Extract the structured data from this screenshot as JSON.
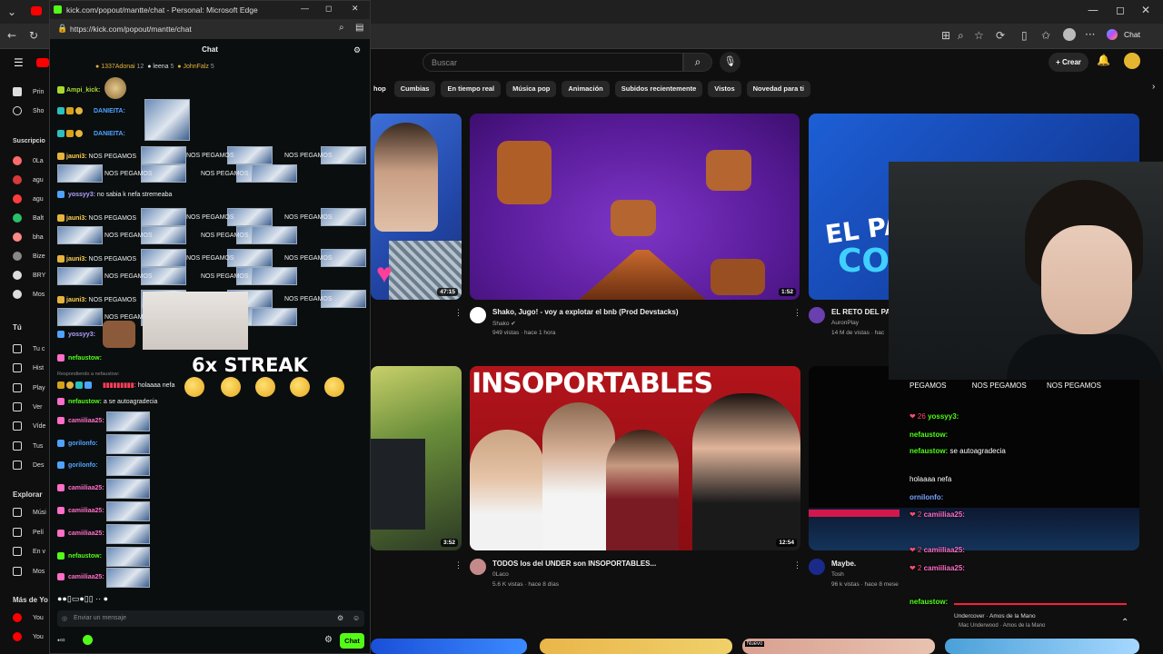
{
  "edge": {
    "window_title": "kick.com/popout/mantte/chat - Personal: Microsoft Edge",
    "url": "https://kick.com/popout/mantte/chat",
    "chat_button": "Chat"
  },
  "youtube": {
    "search_placeholder": "Buscar",
    "create_label": "Crear",
    "chips": [
      "Cumbias",
      "En tiempo real",
      "Música pop",
      "Animación",
      "Subidos recientemente",
      "Vistos",
      "Novedad para ti"
    ],
    "chip_partial": "hop",
    "sidebar": {
      "home": "Prin",
      "shorts": "Sho",
      "subs_header": "Suscripcio",
      "subs": [
        "0La",
        "agu",
        "agu",
        "Balt",
        "bha",
        "Bize",
        "BRY",
        "Mos"
      ],
      "you_header": "Tú",
      "you_items": [
        "Tu c",
        "Hist",
        "Play",
        "Ver",
        "Víde",
        "Tus",
        "Des"
      ],
      "explore_header": "Explorar",
      "explore_items": [
        "Músi",
        "Pelí",
        "En v",
        "Mos"
      ],
      "more_header": "Más de Yo",
      "more_items": [
        "You",
        "You"
      ]
    },
    "videos": [
      {
        "title": "",
        "channel": "",
        "meta": "",
        "duration": "47:15"
      },
      {
        "title": "Shako, Jugo! - voy a explotar el bnb (Prod Devstacks)",
        "channel": "Shako",
        "meta": "949 vistas · hace 1 hora",
        "duration": "1:52"
      },
      {
        "title": "EL RETO DEL PA",
        "channel": "AuronPlay",
        "meta": "14 M de vistas · hac",
        "duration": ""
      },
      {
        "title": "",
        "channel": "",
        "meta": "",
        "duration": "3:52"
      },
      {
        "title": "TODOS los del UNDER son INSOPORTABLES...",
        "channel": "0Laco",
        "meta": "5.6 K vistas · hace 8 días",
        "duration": "12:54"
      },
      {
        "title": "Maybe.",
        "channel": "Tosh",
        "meta": "96 k vistas · hace 8 mese",
        "duration": ""
      }
    ],
    "thumb_text": {
      "insoportables": "INSOPORTABLES",
      "elpal": "EL PAL",
      "co": "CO"
    },
    "bottom_badge": "Nuevo"
  },
  "kick": {
    "header": "Chat",
    "top_gifters": [
      {
        "name": "1337Adonai",
        "count": "12"
      },
      {
        "name": "leena",
        "count": "5"
      },
      {
        "name": "JohnFalz",
        "count": "5"
      }
    ],
    "messages": [
      {
        "user": "Ampi_kick:",
        "text": ""
      },
      {
        "user": "DANIEITA:",
        "text": ""
      },
      {
        "user": "DANIEITA:",
        "text": ""
      },
      {
        "user": "jauni3:",
        "text": "NOS PEGAMOS"
      },
      {
        "user": "yossyy3:",
        "text": "no sabia k nefa stremeaba"
      },
      {
        "user": "jauni3:",
        "text": "NOS PEGAMOS"
      },
      {
        "user": "jauni3:",
        "text": "NOS PEGAMOS"
      },
      {
        "user": "jauni3:",
        "text": "NOS PEGAMOS"
      },
      {
        "user": "yossyy3:",
        "text": ""
      },
      {
        "user": "nefaustow:",
        "text": ""
      },
      {
        "user": "Respondiendo a nefaustow:",
        "text": "Shako"
      },
      {
        "user": "",
        "text": "holaaaa nefa"
      },
      {
        "user": "nefaustow:",
        "text": "a se autoagradecia"
      },
      {
        "user": "camiiliaa25:",
        "text": ""
      },
      {
        "user": "gorilonfo:",
        "text": ""
      },
      {
        "user": "gorilonfo:",
        "text": ""
      },
      {
        "user": "camiiliaa25:",
        "text": ""
      },
      {
        "user": "camiiliaa25:",
        "text": ""
      },
      {
        "user": "camiiliaa25:",
        "text": ""
      },
      {
        "user": "nefaustow:",
        "text": ""
      },
      {
        "user": "camiiliaa25:",
        "text": ""
      }
    ],
    "pegamos": "NOS PEGAMOS",
    "streak": "6x STREAK",
    "input_placeholder": "Enviar un mensaje",
    "send_label": "Chat"
  },
  "overlay": {
    "pegamos": "NOS PEGAMOS",
    "pegamos_partial": "PEGAMOS",
    "messages": [
      {
        "badge": "❤ 26",
        "user": "yossyy3:",
        "text": ""
      },
      {
        "badge": "",
        "user": "nefaustow:",
        "text": ""
      },
      {
        "badge": "",
        "user": "nefaustow:",
        "text": "se autoagradecia"
      },
      {
        "badge": "",
        "user": "",
        "text": "holaaaa nefa"
      },
      {
        "badge": "",
        "user": "ornilonfo:",
        "text": ""
      },
      {
        "badge": "❤ 2",
        "user": "camiiliaa25:",
        "text": ""
      },
      {
        "badge": "❤ 2",
        "user": "camiiliaa25:",
        "text": ""
      },
      {
        "badge": "",
        "user": "nefaustow:",
        "text": ""
      },
      {
        "badge": "❤ 2",
        "user": "camiiliaa25:",
        "text": ""
      }
    ],
    "song_title": "Undercover · Amos de la Mano",
    "song_artist": "Mac Underwood · Amos de la Mano"
  },
  "colors": {
    "kick_green": "#53fc18",
    "yt_red": "#ff0000"
  }
}
